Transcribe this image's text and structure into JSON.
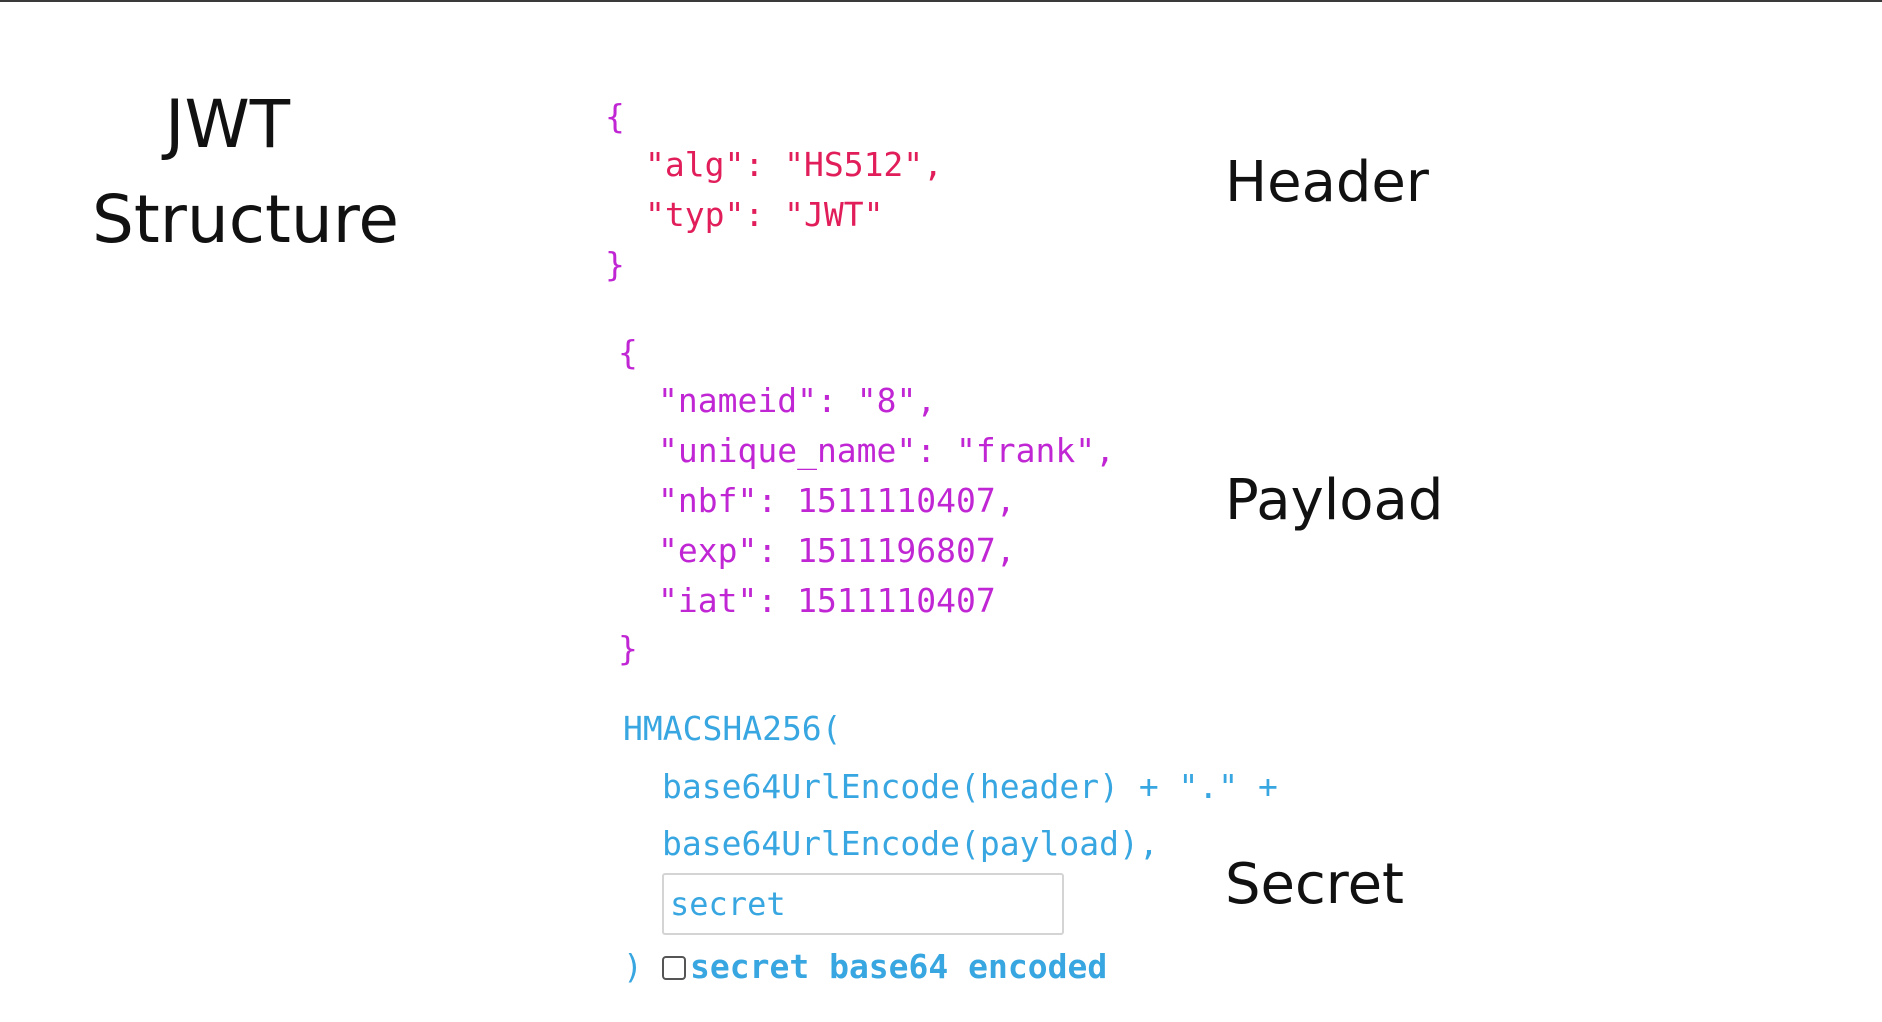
{
  "title": {
    "line1": "JWT",
    "line2": "Structure"
  },
  "labels": {
    "header": "Header",
    "payload": "Payload",
    "secret": "Secret"
  },
  "header_json": {
    "open": "{",
    "alg_key": "\"alg\"",
    "alg_value": "\"HS512\"",
    "typ_key": "\"typ\"",
    "typ_value": "\"JWT\"",
    "close": "}"
  },
  "payload_json": {
    "open": "{",
    "nameid_key": "\"nameid\"",
    "nameid_value": "\"8\"",
    "unique_name_key": "\"unique_name\"",
    "unique_name_value": "\"frank\"",
    "nbf_key": "\"nbf\"",
    "nbf_value": "1511110407",
    "exp_key": "\"exp\"",
    "exp_value": "1511196807",
    "iat_key": "\"iat\"",
    "iat_value": "1511110407",
    "close": "}"
  },
  "signature": {
    "fn_open": "HMACSHA256(",
    "line_header": "base64UrlEncode(header) + \".\" +",
    "line_payload": "base64UrlEncode(payload),",
    "secret_placeholder": "secret",
    "fn_close": ")",
    "base64_checkbox_label": "secret base64 encoded"
  },
  "colors": {
    "json_key": "#c026d3",
    "json_string": "#e11d5a",
    "signature": "#38a6e0",
    "text": "#111111"
  }
}
